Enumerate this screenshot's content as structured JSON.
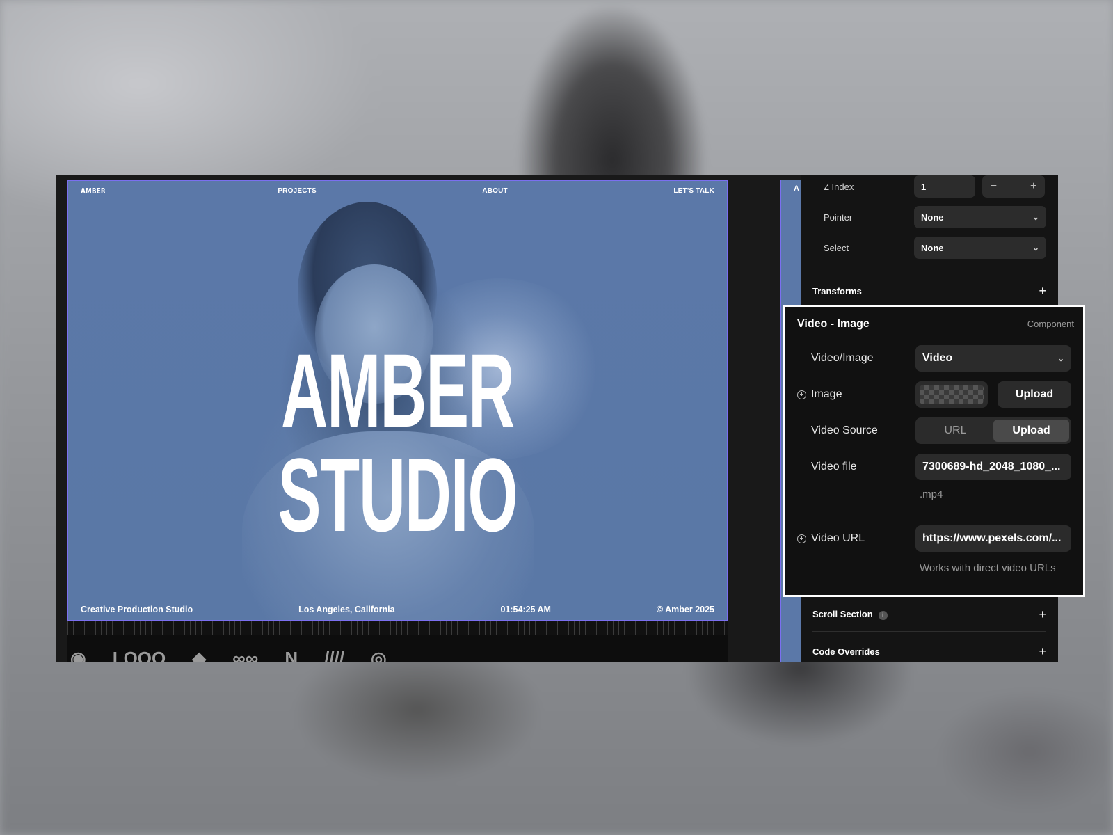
{
  "site": {
    "logo": "AMBER",
    "nav": [
      "PROJECTS",
      "ABOUT",
      "LET'S TALK"
    ],
    "hero_title": "AMBER STUDIO",
    "footer": {
      "tagline": "Creative Production Studio",
      "location": "Los Angeles, California",
      "time": "01:54:25 AM",
      "copyright": "© Amber 2025"
    },
    "gutter_letter": "A"
  },
  "logos": [
    "◉",
    "LOOO",
    "◆",
    "∞∞",
    "N",
    "////",
    "◎"
  ],
  "props": {
    "zindex": {
      "label": "Z Index",
      "value": "1",
      "minus": "−",
      "plus": "+"
    },
    "pointer": {
      "label": "Pointer",
      "value": "None"
    },
    "select": {
      "label": "Select",
      "value": "None"
    },
    "transforms": {
      "label": "Transforms",
      "plus": "+"
    },
    "scroll_section": {
      "label": "Scroll Section",
      "plus": "+",
      "info": "i"
    },
    "code_overrides": {
      "label": "Code Overrides",
      "plus": "+"
    }
  },
  "card": {
    "title": "Video - Image",
    "subtitle": "Component",
    "video_image": {
      "label": "Video/Image",
      "value": "Video"
    },
    "image": {
      "label": "Image",
      "upload": "Upload"
    },
    "video_source": {
      "label": "Video Source",
      "options": [
        "URL",
        "Upload"
      ],
      "selected": "Upload"
    },
    "video_file": {
      "label": "Video file",
      "value": "7300689-hd_2048_1080_...",
      "ext": ".mp4"
    },
    "video_url": {
      "label": "Video URL",
      "value": "https://www.pexels.com/...",
      "hint": "Works with direct video URLs"
    }
  },
  "colors": {
    "accent_outline": "#7b6ff0",
    "hero_tint": "#5b78a8",
    "panel": "#141414"
  }
}
